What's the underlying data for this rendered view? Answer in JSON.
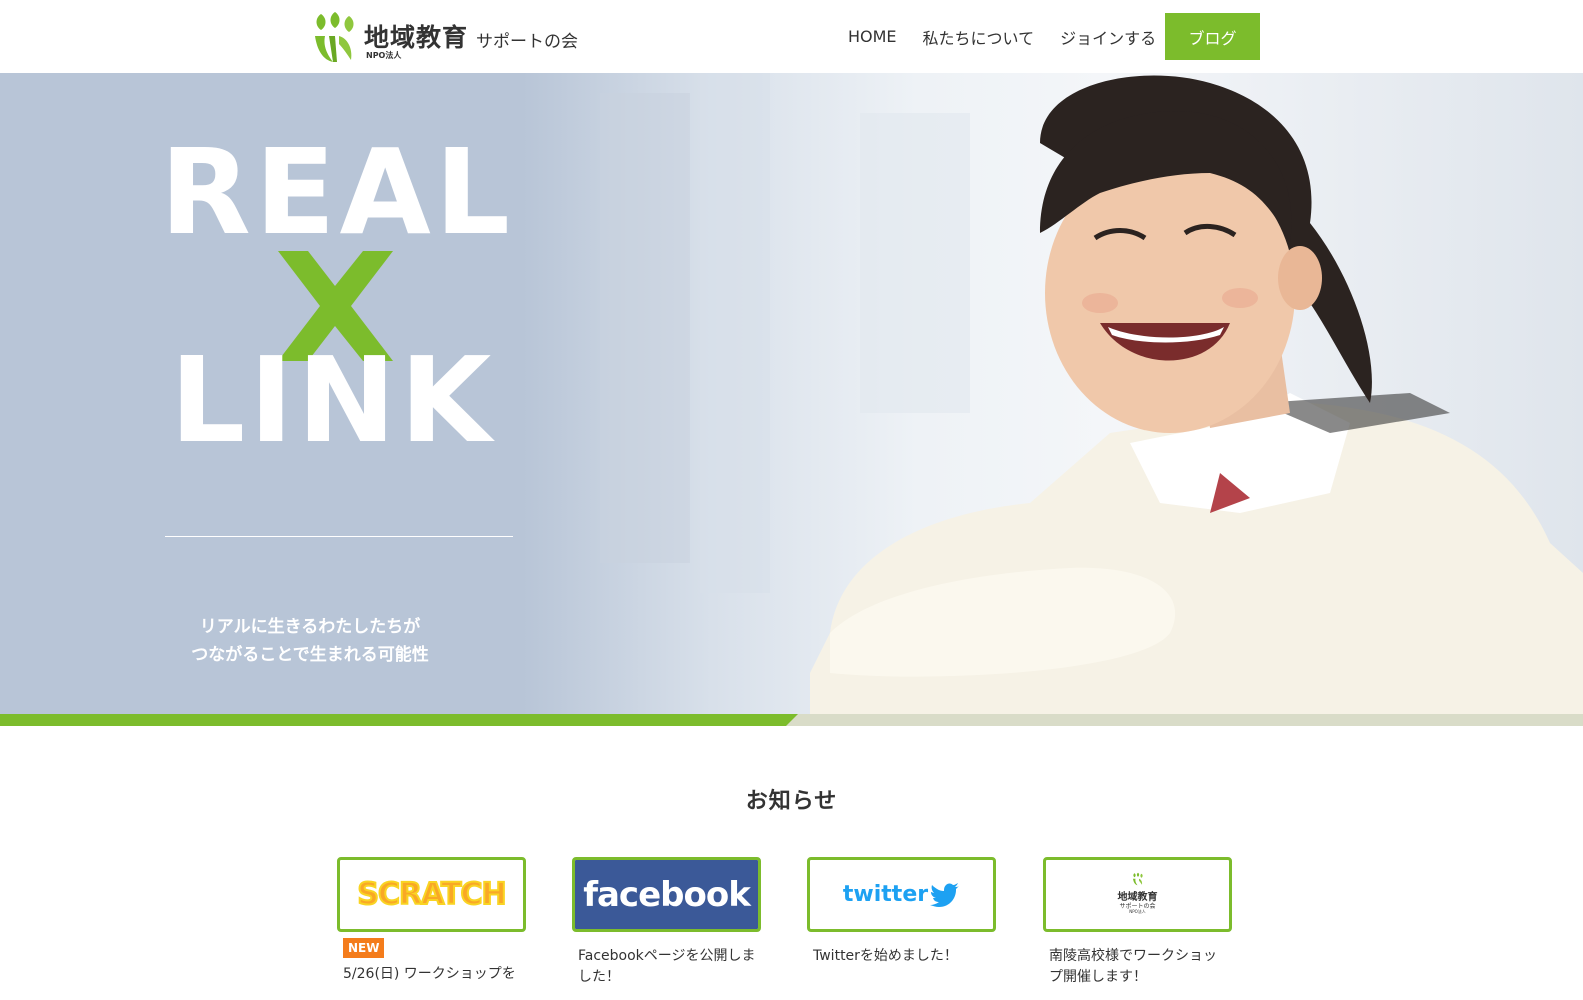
{
  "header": {
    "logo_main": "地域教育",
    "logo_sub": "サポートの会",
    "logo_npo": "NPO法人",
    "nav": [
      {
        "label": "HOME"
      },
      {
        "label": "私たちについて"
      },
      {
        "label": "ジョインする"
      }
    ],
    "blog_label": "ブログ"
  },
  "hero": {
    "headline_top": "REAL",
    "headline_bottom": "LINK",
    "tagline_line1": "リアルに生きるわたしたちが",
    "tagline_line2": "つながることで生まれる可能性"
  },
  "news": {
    "title": "お知らせ",
    "cards": [
      {
        "thumb": "SCRATCH",
        "badge": "NEW",
        "text": "5/26(日) ワークショップを"
      },
      {
        "thumb": "facebook",
        "badge": "",
        "text": "Facebookページを公開しました！"
      },
      {
        "thumb": "twitter",
        "badge": "",
        "text": "Twitterを始めました！"
      },
      {
        "thumb": "",
        "badge": "",
        "text": "南陵高校様でワークショップ開催します！"
      }
    ]
  },
  "colors": {
    "accent": "#7cbc2c",
    "badge": "#f47c1b",
    "hero_left": "#b8c5d7"
  },
  "icons": [
    "logo-leaf-icon",
    "twitter-bird-icon",
    "cross-icon"
  ]
}
